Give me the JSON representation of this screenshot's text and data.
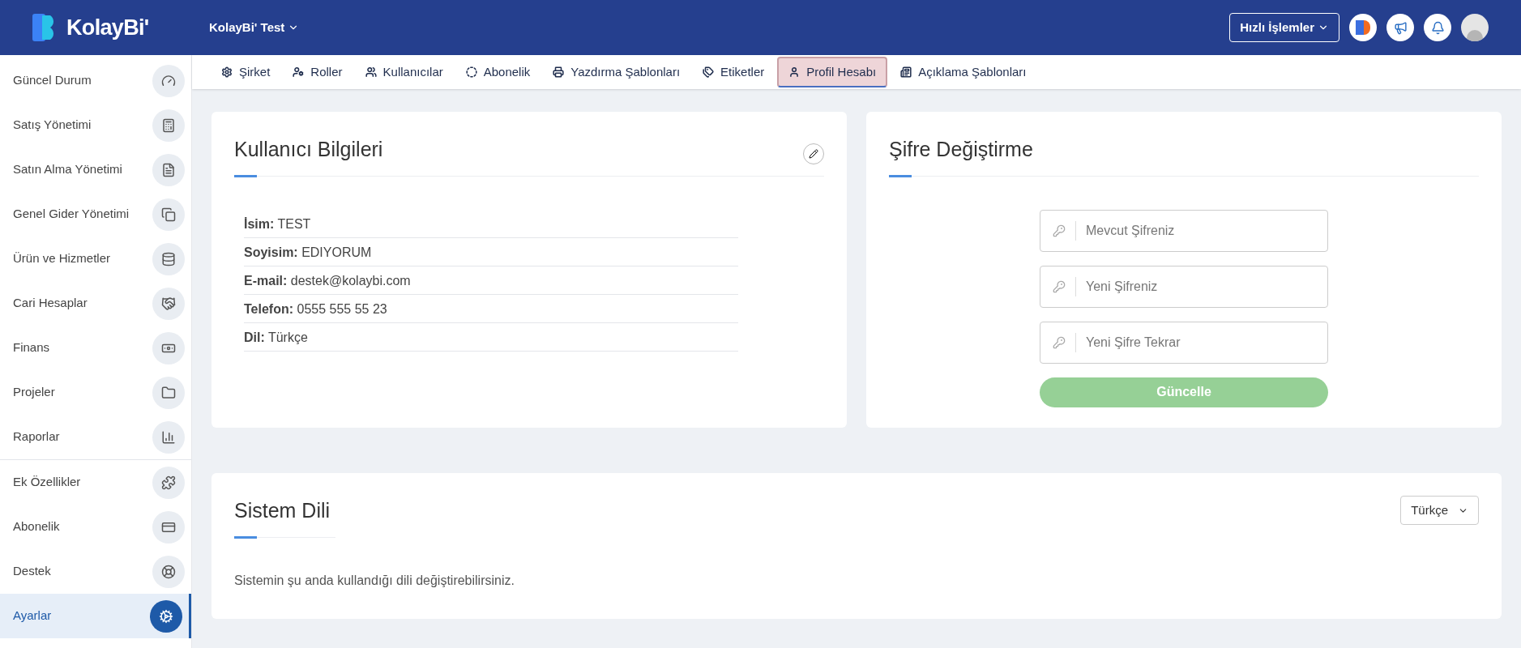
{
  "header": {
    "logo": "KolayBi'",
    "company": "KolayBi' Test",
    "quick_actions": "Hızlı İşlemler"
  },
  "sidebar": {
    "groups": [
      [
        {
          "label": "Güncel Durum",
          "selected": false
        },
        {
          "label": "Satış Yönetimi",
          "selected": false
        },
        {
          "label": "Satın Alma Yönetimi",
          "selected": false
        },
        {
          "label": "Genel Gider Yönetimi",
          "selected": false
        },
        {
          "label": "Ürün ve Hizmetler",
          "selected": false
        },
        {
          "label": "Cari Hesaplar",
          "selected": false
        },
        {
          "label": "Finans",
          "selected": false
        },
        {
          "label": "Projeler",
          "selected": false
        },
        {
          "label": "Raporlar",
          "selected": false
        }
      ],
      [
        {
          "label": "Ek Özellikler",
          "selected": false
        },
        {
          "label": "Abonelik",
          "selected": false
        },
        {
          "label": "Destek",
          "selected": false
        },
        {
          "label": "Ayarlar",
          "selected": true
        }
      ]
    ]
  },
  "tabs": [
    {
      "label": "Şirket",
      "selected": false
    },
    {
      "label": "Roller",
      "selected": false
    },
    {
      "label": "Kullanıcılar",
      "selected": false
    },
    {
      "label": "Abonelik",
      "selected": false
    },
    {
      "label": "Yazdırma Şablonları",
      "selected": false
    },
    {
      "label": "Etiketler",
      "selected": false
    },
    {
      "label": "Profil Hesabı",
      "selected": true
    },
    {
      "label": "Açıklama Şablonları",
      "selected": false
    }
  ],
  "user_info": {
    "title": "Kullanıcı Bilgileri",
    "rows": [
      "**İsim:** TEST",
      "**Soyisim:** EDIYORUM",
      "**E-mail:** destek@kolaybi.com",
      "**Telefon:** 0555 555 55 23",
      "**Dil:** Türkçe"
    ]
  },
  "password_change": {
    "title": "Şifre Değiştirme",
    "fields": [
      {
        "placeholder": "Mevcut Şifreniz"
      },
      {
        "placeholder": "Yeni Şifreniz"
      },
      {
        "placeholder": "Yeni Şifre Tekrar"
      }
    ],
    "button": {
      "label": "Güncelle",
      "disabled": true
    }
  },
  "system_language": {
    "title": "Sistem Dili",
    "selected_language": "Türkçe",
    "description": "Sistemin şu anda kullandığı dili değiştirebilirsiniz."
  }
}
